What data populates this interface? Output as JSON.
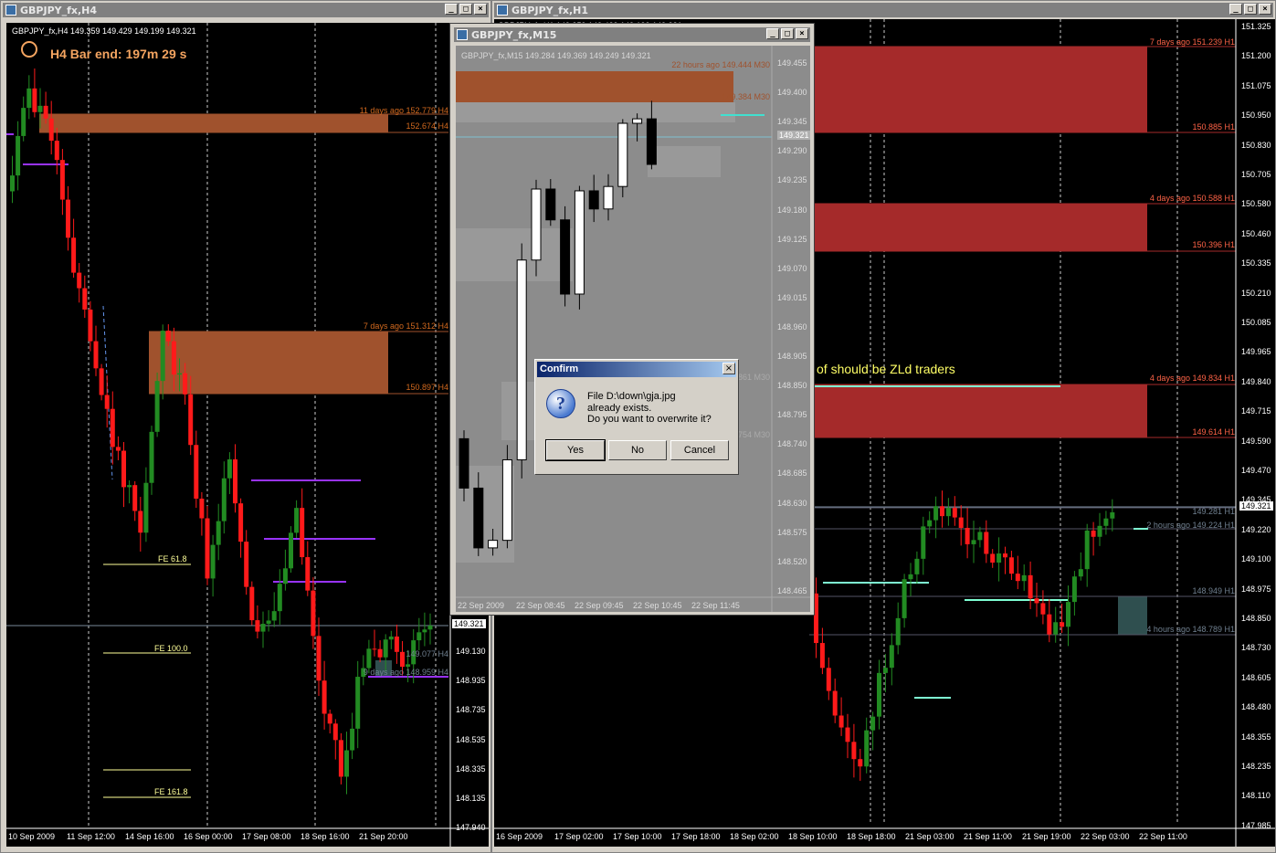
{
  "h4": {
    "title": "GBPJPY_fx,H4",
    "ohlc": "GBPJPY_fx,H4  149.359 149.429 149.199 149.321",
    "bar_end": "H4 Bar end: 197m 29 s",
    "zone1_top": "11 days ago 152.779 H4",
    "zone1_bot": "152.674 H4",
    "zone2_top": "7 days ago 151.312 H4",
    "zone2_bot": "150.897 H4",
    "z3_top": "149.077 H4",
    "z3_bot": "9 days ago 148.959 H4",
    "fe1": "FE 61.8",
    "fe2": "FE 100.0",
    "fe3": "FE 161.8",
    "prices": [
      "149.130",
      "148.935",
      "148.735",
      "148.535",
      "148.335",
      "148.135",
      "147.940"
    ],
    "current": "149.321",
    "dates": [
      "10 Sep 2009",
      "11 Sep 12:00",
      "14 Sep 16:00",
      "16 Sep 00:00",
      "17 Sep 08:00",
      "18 Sep 16:00",
      "21 Sep 20:00"
    ]
  },
  "h1": {
    "title": "GBPJPY_fx,H1",
    "ohlc": "GBPJPY_fx,H1  149.359 149.429 149.199 149.321",
    "zone1_top": "7 days ago 151.239 H1",
    "zone1_bot": "150.885 H1",
    "zone2_top": "4 days ago 150.588 H1",
    "zone2_bot": "150.396 H1",
    "zone3_top": "4 days ago 149.834 H1",
    "zone3_bot": "149.614 H1",
    "l1": "149.281 H1",
    "l2": "2 hours ago 149.224 H1",
    "l3": "148.949 H1",
    "l4": "4 hours ago 148.789 H1",
    "note": "of should be ZLd traders",
    "prices": [
      "151.325",
      "151.200",
      "151.075",
      "150.950",
      "150.830",
      "150.705",
      "150.580",
      "150.460",
      "150.335",
      "150.210",
      "150.085",
      "149.965",
      "149.840",
      "149.715",
      "149.590",
      "149.470",
      "149.345",
      "149.220",
      "149.100",
      "148.975",
      "148.850",
      "148.730",
      "148.605",
      "148.480",
      "148.355",
      "148.235",
      "148.110",
      "147.985"
    ],
    "current": "149.321",
    "dates": [
      "16 Sep 2009",
      "17 Sep 02:00",
      "17 Sep 10:00",
      "17 Sep 18:00",
      "18 Sep 02:00",
      "18 Sep 10:00",
      "18 Sep 18:00",
      "21 Sep 03:00",
      "21 Sep 11:00",
      "21 Sep 19:00",
      "22 Sep 03:00",
      "22 Sep 11:00"
    ]
  },
  "m15": {
    "title": "GBPJPY_fx,M15",
    "ohlc": "GBPJPY_fx,M15  149.284 149.369 149.249 149.321",
    "zone1": "22 hours ago 149.444 M30",
    "zone1b": "149.384 M30",
    "zone2": "148.861 M30",
    "zone3": "148.754 M30",
    "prices": [
      "149.455",
      "149.400",
      "149.345",
      "149.290",
      "149.235",
      "149.180",
      "149.125",
      "149.070",
      "149.015",
      "148.960",
      "148.905",
      "148.850",
      "148.795",
      "148.740",
      "148.685",
      "148.630",
      "148.575",
      "148.520",
      "148.465"
    ],
    "current": "149.321",
    "dates": [
      "22 Sep 2009",
      "22 Sep 08:45",
      "22 Sep 09:45",
      "22 Sep 10:45",
      "22 Sep 11:45"
    ]
  },
  "dialog": {
    "title": "Confirm",
    "line1": "File D:\\down\\gja.jpg",
    "line2": "already exists.",
    "line3": "Do you want to overwrite it?",
    "yes": "Yes",
    "no": "No",
    "cancel": "Cancel"
  },
  "colors": {
    "bull": "#228b22",
    "bear": "#ff1a1a",
    "zone_h4": "#a0522d",
    "zone_h1": "#a52a2a",
    "fe": "#ffff99",
    "purple": "#9933ff",
    "teal": "#7fffd4"
  }
}
